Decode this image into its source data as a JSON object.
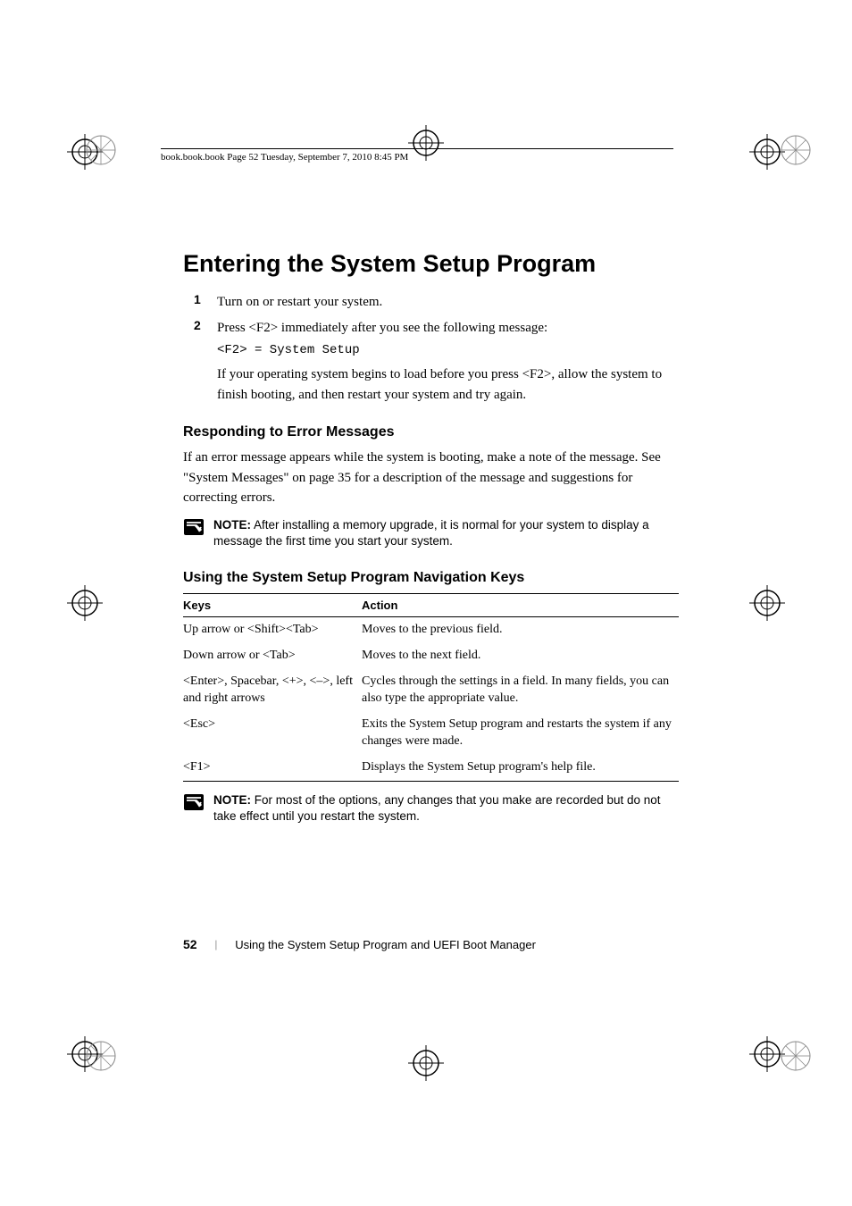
{
  "header": {
    "running_text": "book.book.book  Page 52  Tuesday, September 7, 2010  8:45 PM"
  },
  "main": {
    "title": "Entering the System Setup Program",
    "steps": [
      {
        "num": "1",
        "text": "Turn on or restart your system."
      },
      {
        "num": "2",
        "text": "Press <F2> immediately after you see the following message:"
      }
    ],
    "code_line": "<F2> = System Setup",
    "after_code": "If your operating system begins to load before you press <F2>, allow the system to finish booting, and then restart your system and try again.",
    "h2_1": "Responding to Error Messages",
    "para_1": "If an error message appears while the system is booting, make a note of the message. See \"System Messages\" on page 35 for a description of the message and suggestions for correcting errors.",
    "note_1_label": "NOTE:",
    "note_1_text": " After installing a memory upgrade, it is normal for your system to display a message the first time you start your system.",
    "h2_2": "Using the System Setup Program Navigation Keys",
    "table": {
      "headers": {
        "keys": "Keys",
        "action": "Action"
      },
      "rows": [
        {
          "keys": "Up arrow or <Shift><Tab>",
          "action": "Moves to the previous field."
        },
        {
          "keys": "Down arrow or <Tab>",
          "action": "Moves to the next field."
        },
        {
          "keys": "<Enter>, Spacebar, <+>, <–>, left and right arrows",
          "action": "Cycles through the settings in a field. In many fields, you can also type the appropriate value."
        },
        {
          "keys": "<Esc>",
          "action": "Exits the System Setup program and restarts the system if any changes were made."
        },
        {
          "keys": "<F1>",
          "action": "Displays the System Setup program's help file."
        }
      ]
    },
    "note_2_label": "NOTE:",
    "note_2_text": " For most of the options, any changes that you make are recorded but do not take effect until you restart the system."
  },
  "footer": {
    "page_num": "52",
    "separator": "|",
    "chapter": "Using the System Setup Program and UEFI Boot Manager"
  }
}
